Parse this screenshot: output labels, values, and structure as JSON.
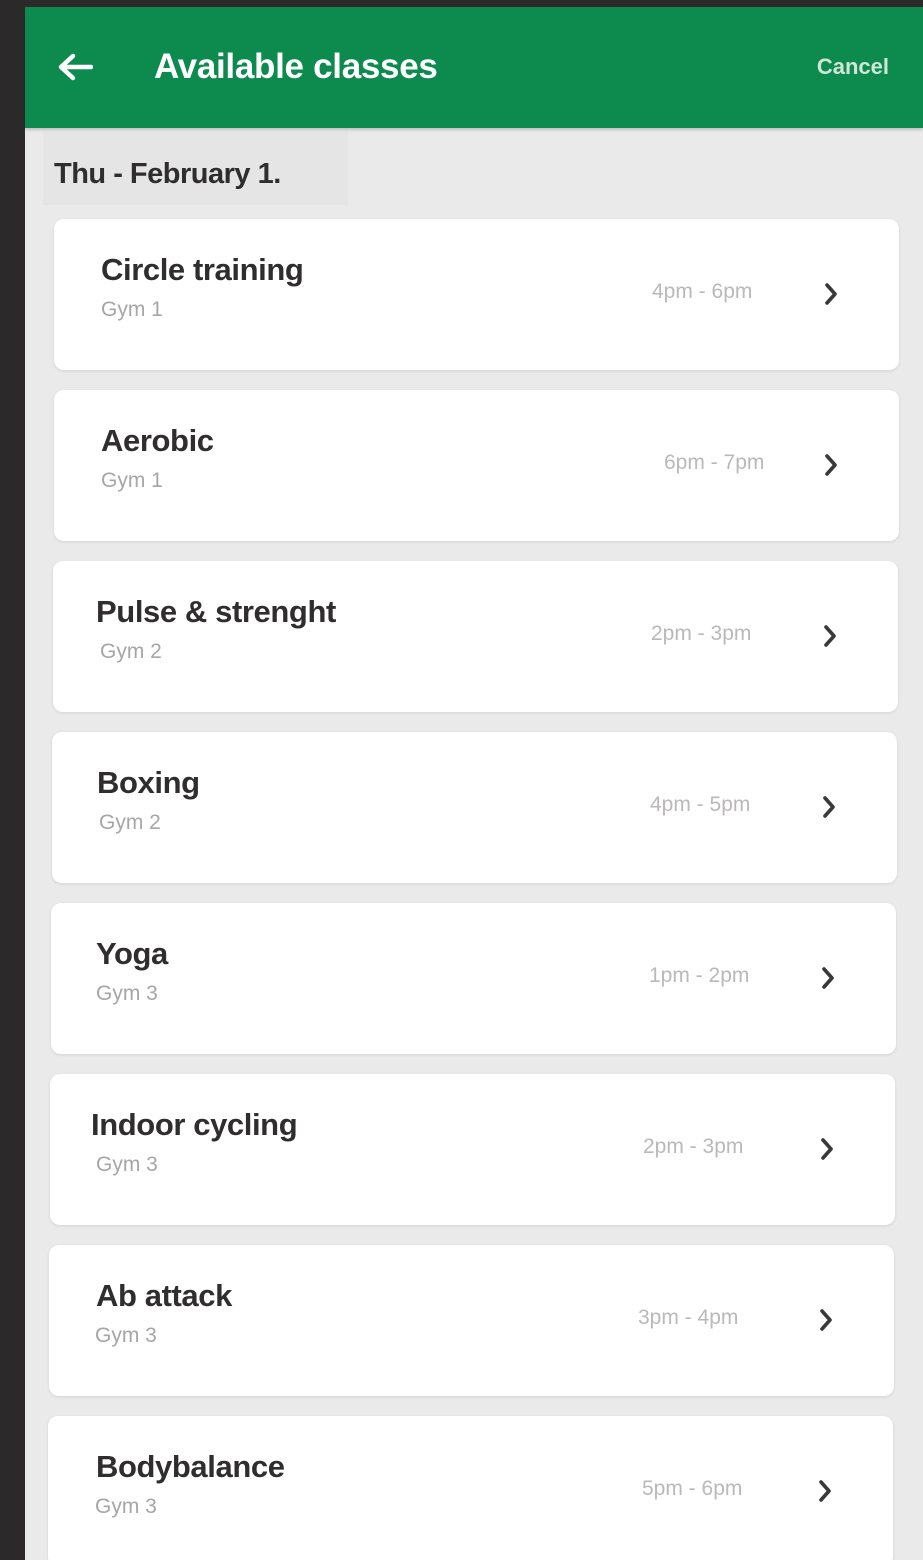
{
  "header": {
    "title": "Available classes",
    "back_icon": "arrow-left-icon",
    "cancel_label": "Cancel"
  },
  "date_heading": "Thu - February 1.",
  "classes": [
    {
      "name": "Circle training",
      "location": "Gym 1",
      "time": "4pm - 6pm"
    },
    {
      "name": "Aerobic",
      "location": "Gym 1",
      "time": "6pm - 7pm"
    },
    {
      "name": "Pulse & strenght",
      "location": "Gym 2",
      "time": "2pm - 3pm"
    },
    {
      "name": "Boxing",
      "location": "Gym 2",
      "time": "4pm - 5pm"
    },
    {
      "name": "Yoga",
      "location": "Gym 3",
      "time": "1pm - 2pm"
    },
    {
      "name": "Indoor cycling",
      "location": "Gym 3",
      "time": "2pm - 3pm"
    },
    {
      "name": "Ab attack",
      "location": "Gym 3",
      "time": "3pm - 4pm"
    },
    {
      "name": "Bodybalance",
      "location": "Gym 3",
      "time": "5pm - 6pm"
    }
  ],
  "colors": {
    "header_bg": "#0d8a4e",
    "header_text": "#ffffff",
    "page_bg": "#ebeaeb",
    "card_bg": "#ffffff",
    "primary_text": "#2f2d2e",
    "secondary_text": "#a7a5a6",
    "chevron": "#3a3839"
  }
}
